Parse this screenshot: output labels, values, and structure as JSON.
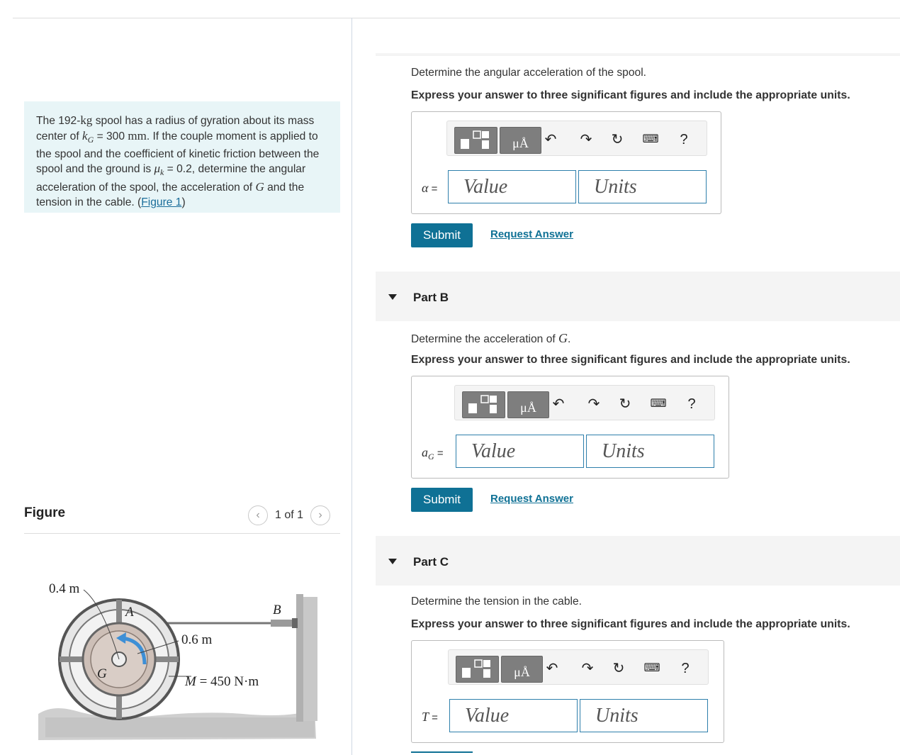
{
  "problem": {
    "t1": "The 192-",
    "kg": "kg",
    "t2": " spool has a radius of gyration about its mass center of ",
    "kG": "k",
    "kGsub": "G",
    "t3": " = 300 ",
    "mm": "mm",
    "t4": ". If the couple moment is applied to the spool and the coefficient of kinetic friction between the spool and the ground is ",
    "mu": "μ",
    "musub": "k",
    "t5": " = 0.2, determine the angular acceleration of the spool, the acceleration of ",
    "G": "G",
    "t6": " and the tension in the cable. (",
    "fig_link": "Figure 1",
    "t7": ")"
  },
  "figure_panel": {
    "title": "Figure",
    "pager": "1 of 1",
    "prev_icon": "chevron-left-icon",
    "next_icon": "chevron-right-icon",
    "labels": {
      "outer_radius": "0.4 m",
      "inner_radius": "0.6 m",
      "point_a": "A",
      "point_b": "B",
      "point_g": "G",
      "moment_M": "M",
      "moment_value": " = 450 N·m"
    }
  },
  "toolbar": {
    "units_btn": "μÅ",
    "icons": [
      "templates-icon",
      "units-icon",
      "undo-icon",
      "redo-icon",
      "reset-icon",
      "keyboard-icon",
      "help-icon"
    ],
    "help": "?"
  },
  "part_a": {
    "question": "Determine the angular acceleration of the spool.",
    "instruction": "Express your answer to three significant figures and include the appropriate units.",
    "symbol": "α",
    "eq": " =",
    "value_placeholder": "Value",
    "units_placeholder": "Units",
    "submit": "Submit",
    "request": "Request Answer"
  },
  "part_b": {
    "title": "Part B",
    "question_pre": "Determine the acceleration of ",
    "question_var": "G",
    "question_post": ".",
    "instruction": "Express your answer to three significant figures and include the appropriate units.",
    "symbol": "a",
    "symbol_sub": "G",
    "eq": " =",
    "value_placeholder": "Value",
    "units_placeholder": "Units",
    "submit": "Submit",
    "request": "Request Answer"
  },
  "part_c": {
    "title": "Part C",
    "question": "Determine the tension in the cable.",
    "instruction": "Express your answer to three significant figures and include the appropriate units.",
    "symbol": "T",
    "eq": " =",
    "value_placeholder": "Value",
    "units_placeholder": "Units"
  },
  "colors": {
    "accent": "#0f7195",
    "problem_bg": "#e8f5f7",
    "field_border": "#2e7fab"
  }
}
